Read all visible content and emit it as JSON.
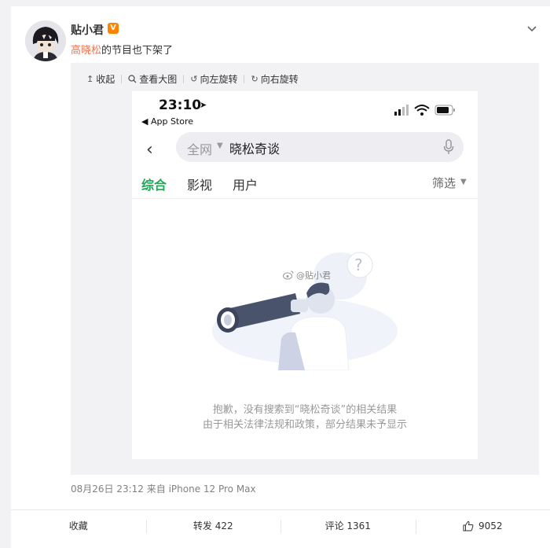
{
  "post": {
    "username": "贴小君",
    "verified_badge": "V",
    "text_link": "高晓松",
    "text_rest": "的节目也下架了",
    "meta": "08月26日 23:12  来自 iPhone 12 Pro Max"
  },
  "toolbar": {
    "collapse": "收起",
    "view_large": "查看大图",
    "rotate_left": "向左旋转",
    "rotate_right": "向右旋转"
  },
  "phone": {
    "time": "23:10",
    "back_label": "◀ App Store",
    "search_scope": "全网",
    "search_value": "晓松奇谈",
    "tabs": [
      "综合",
      "影视",
      "用户"
    ],
    "filter": "筛选",
    "watermark": "@贴小君",
    "msg_line1": "抱歉，没有搜索到“晓松奇谈”的相关结果",
    "msg_line2": "由于相关法律法规和政策，部分结果未予显示"
  },
  "actions": {
    "favorite": "收藏",
    "repost": "转发 422",
    "comment": "评论 1361",
    "like": "9052"
  },
  "colors": {
    "link": "#eb7350",
    "tab_active": "#1aaa55",
    "badge": "#ff8200"
  }
}
